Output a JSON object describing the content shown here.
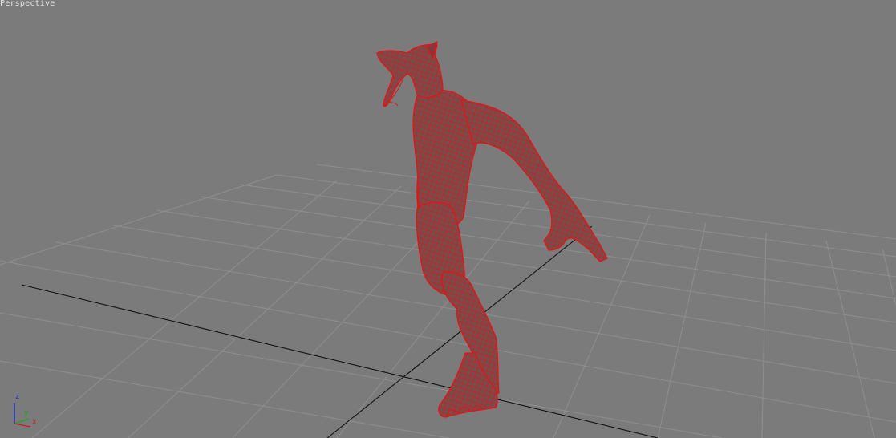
{
  "viewport": {
    "label": "Perspective",
    "background_color": "#7b7b7b",
    "grid_color": "#8e8e8e",
    "world_axis_color": "#101010",
    "model_wire_color": "#e01010"
  },
  "axis_gizmo": {
    "z_label": "z",
    "y_label": "y",
    "x_label": "x",
    "z_color": "#1a2bd0",
    "y_color": "#18a818",
    "x_color": "#d01818"
  }
}
